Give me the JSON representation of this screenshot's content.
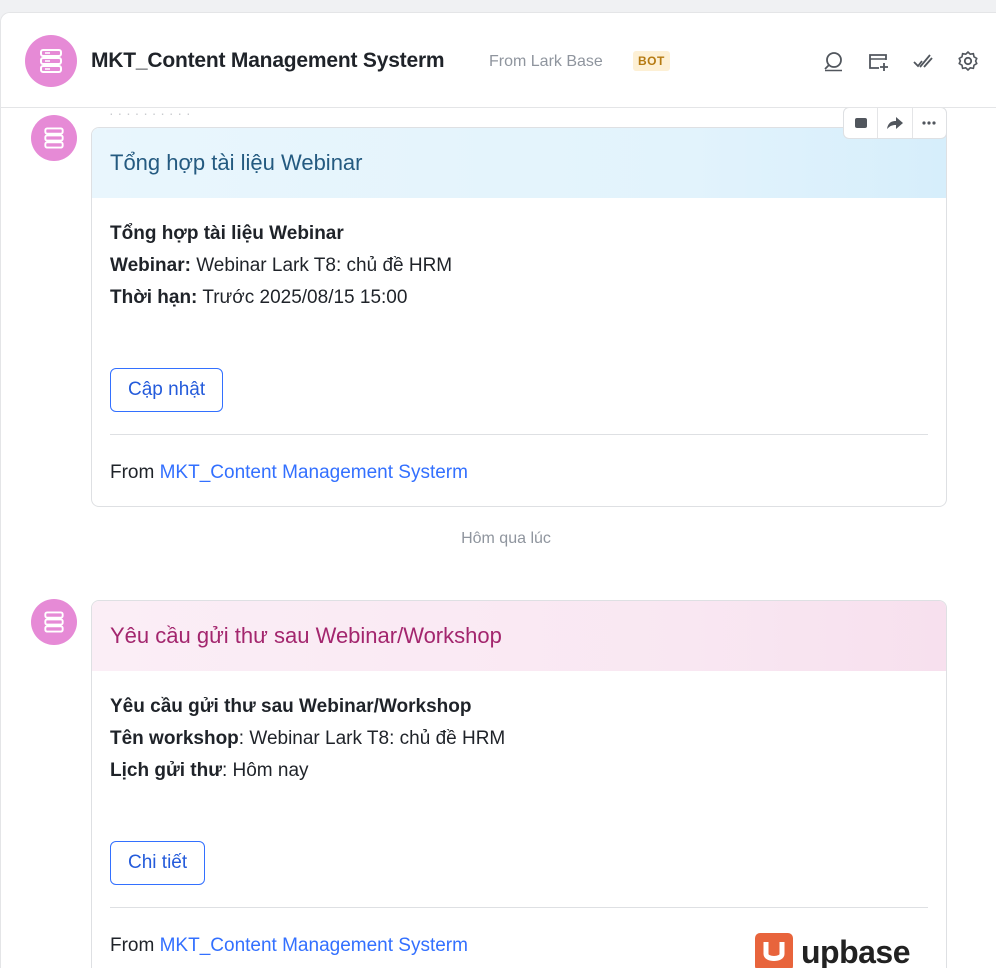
{
  "header": {
    "title": "MKT_Content Management Systerm",
    "subtitle": "From Lark Base",
    "badge": "BOT",
    "icons": [
      "search-chat-icon",
      "add-tab-icon",
      "tasks-icon",
      "settings-icon"
    ]
  },
  "messages": [
    {
      "card_title": "Tổng hợp tài liệu Webinar",
      "theme": "blue",
      "heading_line": "Tổng hợp tài liệu Webinar",
      "fields": [
        {
          "label": "Webinar:",
          "value": " Webinar Lark T8: chủ đề HRM"
        },
        {
          "label": "Thời hạn:",
          "value": " Trước 2025/08/15 15:00"
        }
      ],
      "button_label": "Cập nhật",
      "footer_prefix": "From ",
      "footer_link": "MKT_Content Management Systerm"
    },
    {
      "card_title": "Yêu cầu gửi thư sau Webinar/Workshop",
      "theme": "pink",
      "heading_line": "Yêu cầu gửi thư sau Webinar/Workshop",
      "fields": [
        {
          "label": "Tên workshop",
          "value": ": Webinar Lark T8: chủ đề HRM"
        },
        {
          "label": "Lịch gửi thư",
          "value": ": Hôm nay"
        }
      ],
      "button_label": "Chi tiết",
      "footer_prefix": "From ",
      "footer_link": "MKT_Content Management Systerm"
    }
  ],
  "timestamp": "Hôm qua lúc",
  "watermark": "upbase",
  "colors": {
    "accent": "#3370ff",
    "avatar": "#e68ad6",
    "blue_title": "#245a80",
    "pink_title": "#a3266e"
  }
}
